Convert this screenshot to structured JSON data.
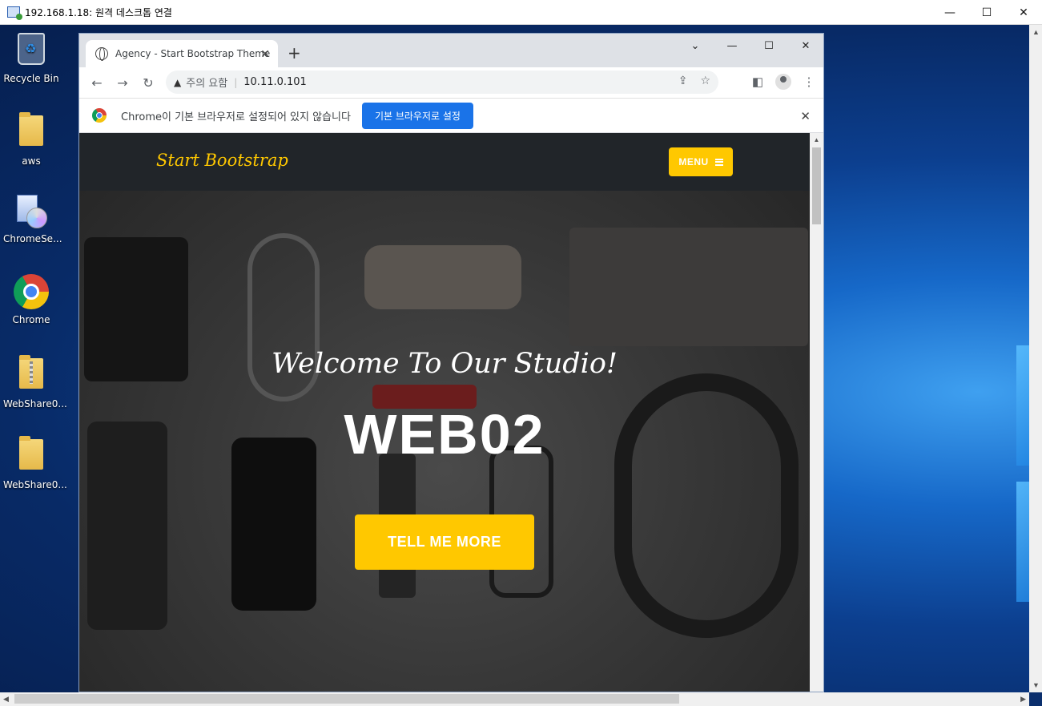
{
  "rdp": {
    "title": "192.168.1.18: 원격 데스크톱 연결",
    "minimize": "—",
    "maximize": "☐",
    "close": "✕"
  },
  "desktop": {
    "icons": [
      {
        "label": "Recycle Bin",
        "icon": "recycle-bin-icon"
      },
      {
        "label": "aws",
        "icon": "folder-icon"
      },
      {
        "label": "ChromeSe...",
        "icon": "setup-cd-icon"
      },
      {
        "label": "Chrome",
        "icon": "chrome-icon"
      },
      {
        "label": "WebShare0...",
        "icon": "zip-folder-icon"
      },
      {
        "label": "WebShare0...",
        "icon": "folder-icon"
      }
    ]
  },
  "browser": {
    "tab_title": "Agency - Start Bootstrap Theme",
    "tab_close": "✕",
    "new_tab": "+",
    "tab_search": "⌄",
    "minimize": "—",
    "maximize": "☐",
    "close": "✕",
    "back": "←",
    "forward": "→",
    "reload": "↻",
    "security_warning": "주의 요함",
    "url": "10.11.0.101",
    "share": "⇪",
    "bookmark": "☆",
    "side_panel": "◧",
    "more": "⋮",
    "infobar": {
      "text": "Chrome이 기본 브라우저로 설정되어 있지 않습니다",
      "button": "기본 브라우저로 설정",
      "close": "✕"
    }
  },
  "page": {
    "brand": "Start Bootstrap",
    "menu_label": "MENU",
    "hero_subheading": "Welcome To Our Studio!",
    "hero_heading": "WEB02",
    "hero_button": "TELL ME MORE"
  },
  "colors": {
    "accent": "#ffc800",
    "navbar": "#212529",
    "chrome_blue": "#1a73e8"
  }
}
